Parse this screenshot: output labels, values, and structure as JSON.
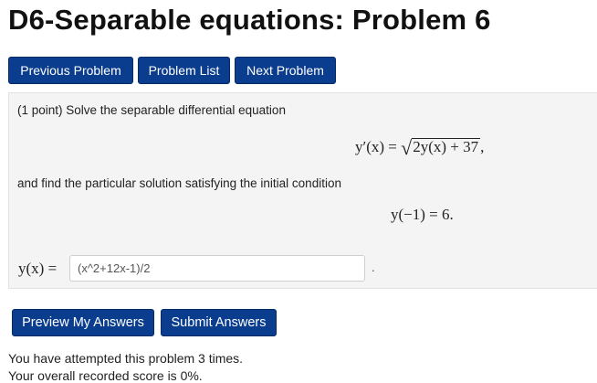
{
  "page_title": "D6-Separable equations: Problem 6",
  "nav": {
    "previous": "Previous Problem",
    "list": "Problem List",
    "next": "Next Problem"
  },
  "problem": {
    "intro": "(1 point) Solve the separable differential equation",
    "equation": {
      "lhs": "y′(x) =",
      "radicand": "2y(x) + 37",
      "trail": ","
    },
    "condition_text": "and find the particular solution satisfying the initial condition",
    "initial_condition": "y(−1) = 6.",
    "answer_label": "y(x) =",
    "answer_value": "(x^2+12x-1)/2",
    "answer_trail": "."
  },
  "actions": {
    "preview": "Preview My Answers",
    "submit": "Submit Answers"
  },
  "status": {
    "attempts": "You have attempted this problem 3 times.",
    "score": "Your overall recorded score is 0%."
  },
  "colors": {
    "button_bg": "#0b3d8e",
    "problem_bg": "#f4f4f4"
  }
}
